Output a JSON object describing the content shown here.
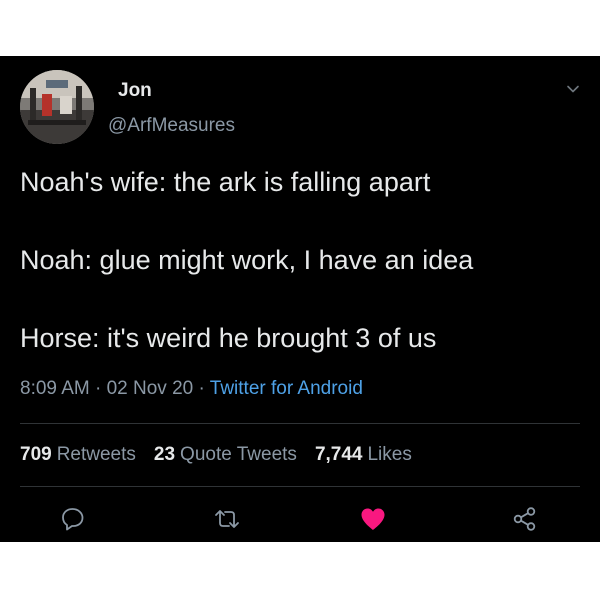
{
  "user": {
    "name": "Jon",
    "handle": "@ArfMeasures"
  },
  "tweet": {
    "lines": [
      "Noah's wife: the ark is falling apart",
      "Noah: glue might work, I have an idea",
      "Horse: it's weird he brought 3 of us"
    ]
  },
  "meta": {
    "time": "8:09 AM",
    "sep1": " · ",
    "date": "02 Nov 20",
    "sep2": " · ",
    "source": "Twitter for Android"
  },
  "stats": {
    "retweets": {
      "count": "709",
      "label": "Retweets"
    },
    "quotes": {
      "count": "23",
      "label": "Quote Tweets"
    },
    "likes": {
      "count": "7,744",
      "label": "Likes"
    }
  },
  "actions": {
    "reply_icon": "reply-icon",
    "retweet_icon": "retweet-icon",
    "like_icon": "heart-icon",
    "share_icon": "share-icon"
  },
  "colors": {
    "background": "#000000",
    "text": "#e7e9ea",
    "muted": "#8b98a5",
    "link": "#4ea1e6",
    "like": "#f91880"
  }
}
